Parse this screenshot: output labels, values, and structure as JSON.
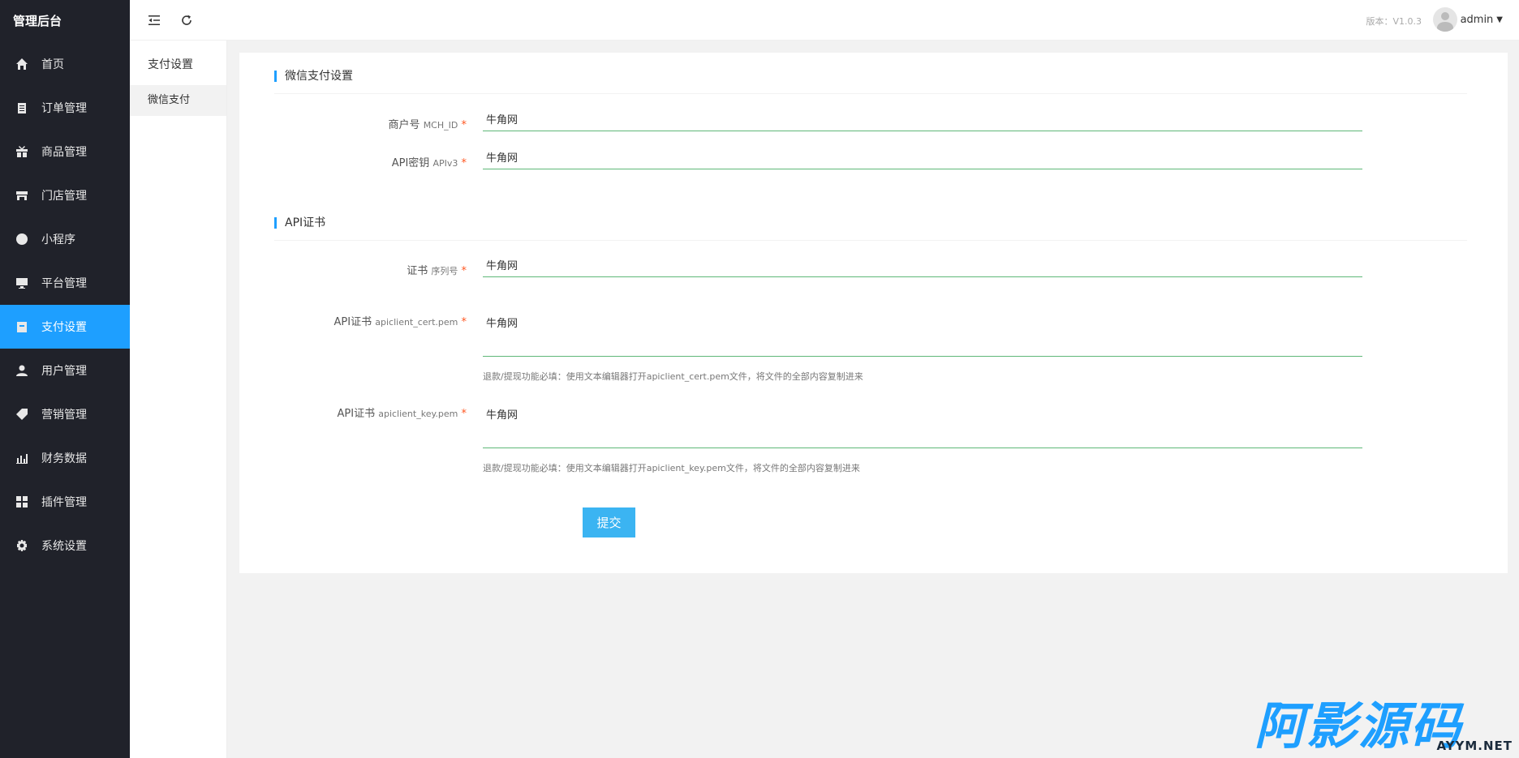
{
  "sidebar": {
    "brand": "管理后台",
    "items": [
      {
        "label": "首页",
        "icon": "home-icon"
      },
      {
        "label": "订单管理",
        "icon": "clipboard-icon"
      },
      {
        "label": "商品管理",
        "icon": "gift-icon"
      },
      {
        "label": "门店管理",
        "icon": "store-icon"
      },
      {
        "label": "小程序",
        "icon": "mini-program-icon"
      },
      {
        "label": "平台管理",
        "icon": "monitor-icon"
      },
      {
        "label": "支付设置",
        "icon": "wallet-icon",
        "active": true
      },
      {
        "label": "用户管理",
        "icon": "user-icon"
      },
      {
        "label": "营销管理",
        "icon": "tag-icon"
      },
      {
        "label": "财务数据",
        "icon": "bar-chart-icon"
      },
      {
        "label": "插件管理",
        "icon": "plugin-icon"
      },
      {
        "label": "系统设置",
        "icon": "gear-icon"
      }
    ],
    "active_color": "#1e9fff"
  },
  "subnav": {
    "title": "支付设置",
    "items": [
      {
        "label": "微信支付"
      }
    ]
  },
  "topbar": {
    "collapse_icon": "menu-collapse-icon",
    "refresh_icon": "refresh-icon",
    "version": "版本：V1.0.3",
    "username": "admin"
  },
  "form": {
    "section1_title": "微信支付设置",
    "mch_id": {
      "label": "商户号",
      "sub": "MCH_ID",
      "value": "牛角网"
    },
    "apiv3": {
      "label": "API密钥",
      "sub": "APIv3",
      "value": "牛角网"
    },
    "section2_title": "API证书",
    "serial": {
      "label": "证书",
      "sub": "序列号",
      "value": "牛角网"
    },
    "cert": {
      "label": "API证书",
      "sub": "apiclient_cert.pem",
      "value": "牛角网",
      "help": "退款/提现功能必填：使用文本编辑器打开apiclient_cert.pem文件，将文件的全部内容复制进来"
    },
    "key": {
      "label": "API证书",
      "sub": "apiclient_key.pem",
      "value": "牛角网",
      "help": "退款/提现功能必填：使用文本编辑器打开apiclient_key.pem文件，将文件的全部内容复制进来"
    },
    "required_mark": "*",
    "submit_label": "提交"
  },
  "watermark": {
    "text": "阿影源码",
    "sub": "AYYM.NET"
  }
}
